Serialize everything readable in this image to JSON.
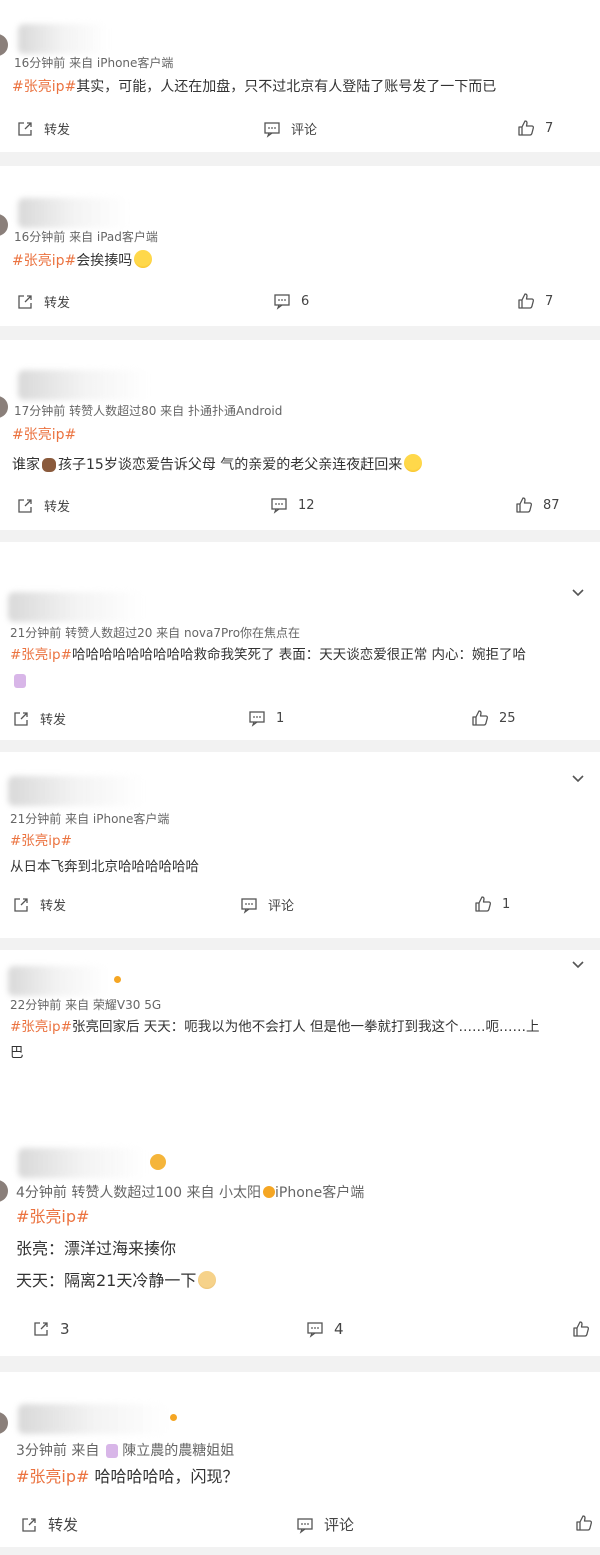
{
  "posts": [
    {
      "meta": "16分钟前  来自 iPhone客户端",
      "tag": "#张亮ip#",
      "text": "其实，可能，人还在加盘，只不过北京有人登陆了账号发了一下而已",
      "repost": "转发",
      "comment": "评论",
      "likes": "7"
    },
    {
      "meta": "16分钟前  来自 iPad客户端",
      "tag": "#张亮ip#",
      "text": "会挨揍吗",
      "emoji": "laugh-emoji",
      "repost": "转发",
      "comment": "6",
      "likes": "7"
    },
    {
      "meta": "17分钟前  转赞人数超过80  来自 扑通扑通Android",
      "tag": "#张亮ip#",
      "text_a": "谁家",
      "text_b": "孩子15岁谈恋爱告诉父母 气的亲爱的老父亲连夜赶回来",
      "repost": "转发",
      "comment": "12",
      "likes": "87"
    },
    {
      "meta": "21分钟前  转赞人数超过20  来自 nova7Pro你在焦点在",
      "tag": "#张亮ip#",
      "text": "哈哈哈哈哈哈哈哈哈救命我笑死了 表面：天天谈恋爱很正常 内心：婉拒了哈",
      "repost": "转发",
      "comment": "1",
      "likes": "25"
    },
    {
      "meta": "21分钟前  来自 iPhone客户端",
      "tag": "#张亮ip#",
      "text": "从日本飞奔到北京哈哈哈哈哈哈",
      "repost": "转发",
      "comment": "评论",
      "likes": "1"
    },
    {
      "meta": "22分钟前  来自 荣耀V30 5G",
      "tag": "#张亮ip#",
      "text": "张亮回家后 天天：呃我以为他不会打人 但是他一拳就打到我这个……呃……上",
      "text2": "巴"
    },
    {
      "meta_a": "4分钟前  转赞人数超过100  来自 小太阳",
      "meta_b": "iPhone客户端",
      "tag": "#张亮ip#",
      "line1": "张亮：漂洋过海来揍你",
      "line2": "天天：隔离21天冷静一下",
      "repost": "3",
      "comment": "4"
    },
    {
      "meta_a": "3分钟前  来自",
      "meta_b": "陳立農的農糖姐姐",
      "tag": "#张亮ip#",
      "text": " 哈哈哈哈哈，闪现？",
      "repost": "转发",
      "comment": "评论"
    }
  ],
  "icons": {
    "repost": "share-icon",
    "comment": "comment-icon",
    "like": "thumbs-up-icon",
    "more": "chevron-down-icon"
  },
  "colors": {
    "tag": "#eb7340",
    "separator": "#f2f2f2"
  }
}
